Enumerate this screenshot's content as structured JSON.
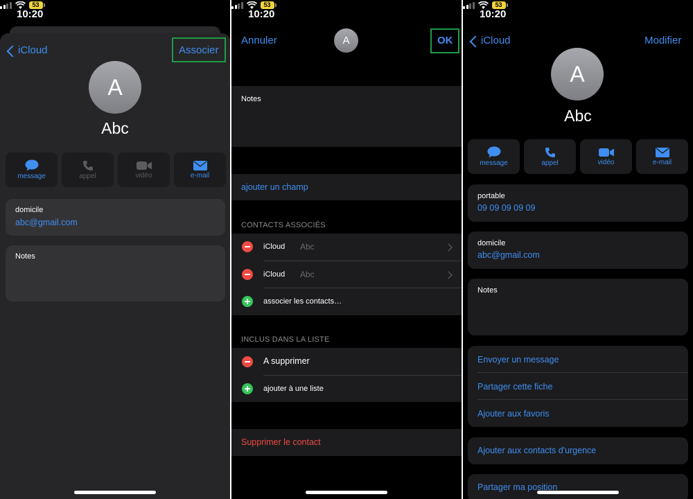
{
  "status": {
    "time": "10:20",
    "battery": "53"
  },
  "screen1": {
    "back_label": "iCloud",
    "action_label": "Associer",
    "avatar_initial": "A",
    "contact_name": "Abc",
    "actions": [
      {
        "label": "message",
        "icon": "message-icon",
        "enabled": true
      },
      {
        "label": "appel",
        "icon": "phone-icon",
        "enabled": false
      },
      {
        "label": "vidéo",
        "icon": "video-icon",
        "enabled": false
      },
      {
        "label": "e-mail",
        "icon": "mail-icon",
        "enabled": true
      }
    ],
    "email_label": "domicile",
    "email_value": "abc@gmail.com",
    "notes_label": "Notes"
  },
  "screen2": {
    "cancel_label": "Annuler",
    "ok_label": "OK",
    "avatar_initial": "A",
    "notes_label": "Notes",
    "add_field_label": "ajouter un champ",
    "linked_header": "CONTACTS ASSOCIÉS",
    "linked": [
      {
        "source": "iCloud",
        "name": "Abc"
      },
      {
        "source": "iCloud",
        "name": "Abc"
      }
    ],
    "link_contacts_label": "associer les contacts…",
    "lists_header": "INCLUS DANS LA LISTE",
    "list_item": "A supprimer",
    "add_to_list_label": "ajouter à une liste",
    "delete_contact_label": "Supprimer le contact"
  },
  "screen3": {
    "back_label": "iCloud",
    "edit_label": "Modifier",
    "avatar_initial": "A",
    "contact_name": "Abc",
    "actions": [
      {
        "label": "message",
        "icon": "message-icon"
      },
      {
        "label": "appel",
        "icon": "phone-icon"
      },
      {
        "label": "vidéo",
        "icon": "video-icon"
      },
      {
        "label": "e-mail",
        "icon": "mail-icon"
      }
    ],
    "phone_label": "portable",
    "phone_value": "09 09 09 09 09",
    "email_label": "domicile",
    "email_value": "abc@gmail.com",
    "notes_label": "Notes",
    "options": [
      "Envoyer un message",
      "Partager cette fiche",
      "Ajouter aux favoris"
    ],
    "emergency_label": "Ajouter aux contacts d'urgence",
    "share_location_label": "Partager ma position"
  },
  "colors": {
    "accent": "#3f8ef0",
    "destructive": "#ee4b44",
    "add": "#35c659",
    "highlight": "#1f9a47"
  }
}
